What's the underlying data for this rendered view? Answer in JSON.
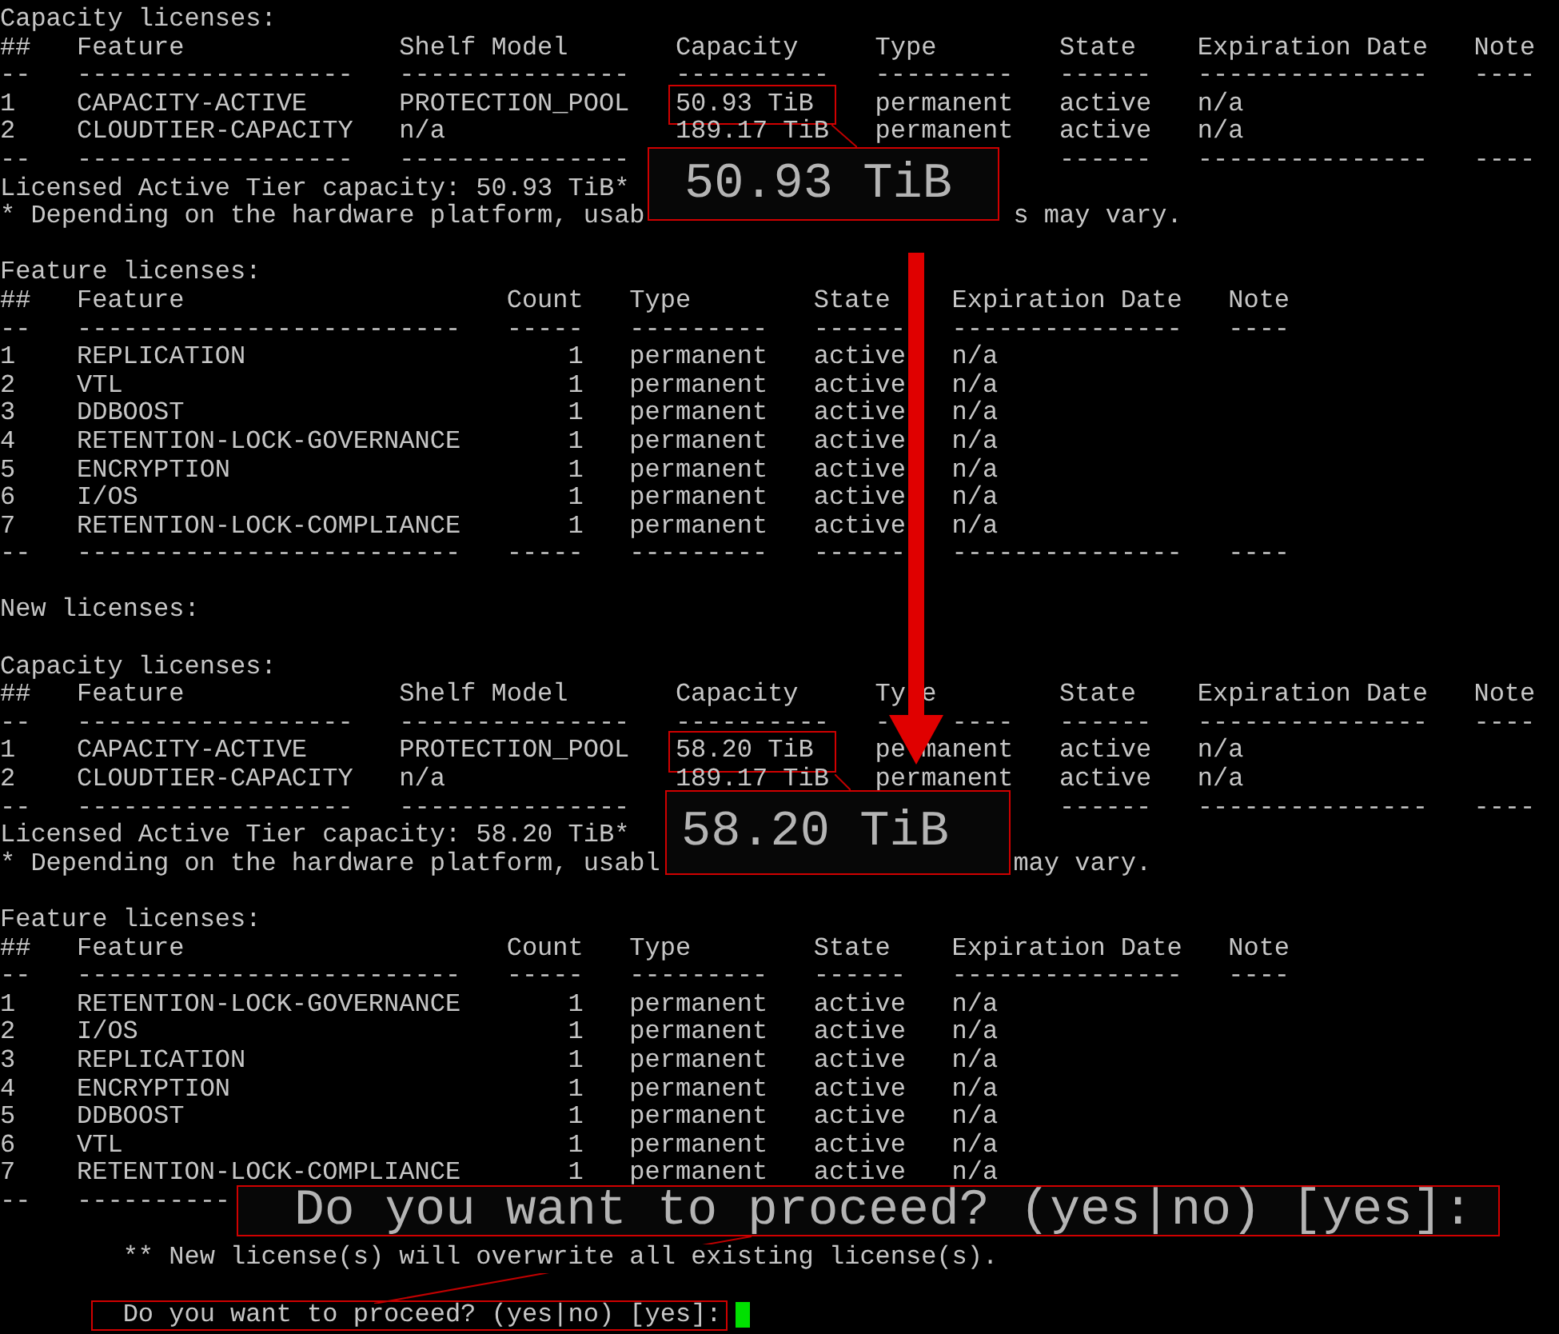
{
  "lines": [
    {
      "kind": "text",
      "text": "Capacity licenses:"
    },
    {
      "kind": "cap_header",
      "cells": [
        "##",
        "Feature",
        "Shelf Model",
        "Capacity",
        "Type",
        "State",
        "Expiration Date",
        "Note"
      ]
    },
    {
      "kind": "cap_rule",
      "cells": [
        "--",
        "------------------",
        "---------------",
        "----------",
        "---------",
        "------",
        "---------------",
        "----"
      ]
    },
    {
      "kind": "cap_row",
      "highlighted": true,
      "cells": [
        "1",
        "CAPACITY-ACTIVE",
        "PROTECTION_POOL",
        "50.93 TiB",
        "permanent",
        "active",
        "n/a"
      ]
    },
    {
      "kind": "cap_row",
      "highlighted": false,
      "cells": [
        "2",
        "CLOUDTIER-CAPACITY",
        "n/a",
        "189.17 TiB",
        "permanent",
        "active",
        "n/a"
      ]
    },
    {
      "kind": "cap_rule",
      "cells": [
        "--",
        "------------------",
        "---------------",
        null,
        null,
        "------",
        "---------------",
        "----"
      ]
    },
    {
      "kind": "text",
      "text": "Licensed Active Tier capacity: 50.93 TiB*"
    },
    {
      "kind": "split",
      "parts": [
        "* Depending on the hardware platform, usab",
        "s may vary."
      ]
    },
    {
      "kind": "blank"
    },
    {
      "kind": "text",
      "text": "Feature licenses:"
    },
    {
      "kind": "feat_header",
      "cells": [
        "##",
        "Feature",
        "Count",
        "Type",
        "State",
        "Expiration Date",
        "Note"
      ]
    },
    {
      "kind": "feat_rule",
      "cells": [
        "--",
        "-------------------------",
        "-----",
        "---------",
        "------",
        "---------------",
        "----"
      ]
    },
    {
      "kind": "feat_row",
      "highlighted": false,
      "cells": [
        "1",
        "REPLICATION",
        "1",
        "permanent",
        "active",
        "n/a"
      ]
    },
    {
      "kind": "feat_row",
      "highlighted": false,
      "cells": [
        "2",
        "VTL",
        "1",
        "permanent",
        "active",
        "n/a"
      ]
    },
    {
      "kind": "feat_row",
      "highlighted": false,
      "cells": [
        "3",
        "DDBOOST",
        "1",
        "permanent",
        "active",
        "n/a"
      ]
    },
    {
      "kind": "feat_row",
      "highlighted": false,
      "cells": [
        "4",
        "RETENTION-LOCK-GOVERNANCE",
        "1",
        "permanent",
        "active",
        "n/a"
      ]
    },
    {
      "kind": "feat_row",
      "highlighted": false,
      "cells": [
        "5",
        "ENCRYPTION",
        "1",
        "permanent",
        "active",
        "n/a"
      ]
    },
    {
      "kind": "feat_row",
      "highlighted": false,
      "cells": [
        "6",
        "I/OS",
        "1",
        "permanent",
        "active",
        "n/a"
      ]
    },
    {
      "kind": "feat_row",
      "highlighted": false,
      "cells": [
        "7",
        "RETENTION-LOCK-COMPLIANCE",
        "1",
        "permanent",
        "active",
        "n/a"
      ]
    },
    {
      "kind": "feat_rule",
      "cells": [
        "--",
        "-------------------------",
        "-----",
        "---------",
        "------",
        "---------------",
        "----"
      ]
    },
    {
      "kind": "blank"
    },
    {
      "kind": "text",
      "text": "New licenses:"
    },
    {
      "kind": "blank"
    },
    {
      "kind": "text",
      "text": "Capacity licenses:"
    },
    {
      "kind": "cap_header",
      "cells": [
        "##",
        "Feature",
        "Shelf Model",
        "Capacity",
        [
          "Ty",
          "e"
        ],
        "State",
        "Expiration Date",
        "Note"
      ]
    },
    {
      "kind": "cap_rule",
      "cells": [
        "--",
        "------------------",
        "---------------",
        "----------",
        [
          "-",
          "----"
        ],
        "------",
        "---------------",
        "----"
      ]
    },
    {
      "kind": "cap_row",
      "highlighted": true,
      "cells": [
        "1",
        "CAPACITY-ACTIVE",
        "PROTECTION_POOL",
        "58.20 TiB",
        [
          "pe",
          "manent"
        ],
        "active",
        "n/a"
      ]
    },
    {
      "kind": "cap_row",
      "highlighted": false,
      "cells": [
        "2",
        "CLOUDTIER-CAPACITY",
        "n/a",
        "189.17 TiB",
        "permanent",
        "active",
        "n/a"
      ]
    },
    {
      "kind": "cap_rule",
      "cells": [
        "--",
        "------------------",
        "---------------",
        null,
        null,
        "------",
        "---------------",
        "----"
      ]
    },
    {
      "kind": "text",
      "text": "Licensed Active Tier capacity: 58.20 TiB*"
    },
    {
      "kind": "split",
      "parts": [
        "* Depending on the hardware platform, usabl",
        "may vary."
      ]
    },
    {
      "kind": "blank"
    },
    {
      "kind": "text",
      "text": "Feature licenses:"
    },
    {
      "kind": "feat_header",
      "cells": [
        "##",
        "Feature",
        "Count",
        "Type",
        "State",
        "Expiration Date",
        "Note"
      ]
    },
    {
      "kind": "feat_rule",
      "cells": [
        "--",
        "-------------------------",
        "-----",
        "---------",
        "------",
        "---------------",
        "----"
      ]
    },
    {
      "kind": "feat_row",
      "highlighted": false,
      "cells": [
        "1",
        "RETENTION-LOCK-GOVERNANCE",
        "1",
        "permanent",
        "active",
        "n/a"
      ]
    },
    {
      "kind": "feat_row",
      "highlighted": false,
      "cells": [
        "2",
        "I/OS",
        "1",
        "permanent",
        "active",
        "n/a"
      ]
    },
    {
      "kind": "feat_row",
      "highlighted": false,
      "cells": [
        "3",
        "REPLICATION",
        "1",
        "permanent",
        "active",
        "n/a"
      ]
    },
    {
      "kind": "feat_row",
      "highlighted": false,
      "cells": [
        "4",
        "ENCRYPTION",
        "1",
        "permanent",
        "active",
        "n/a"
      ]
    },
    {
      "kind": "feat_row",
      "highlighted": false,
      "cells": [
        "5",
        "DDBOOST",
        "1",
        "permanent",
        "active",
        "n/a"
      ]
    },
    {
      "kind": "feat_row",
      "highlighted": false,
      "cells": [
        "6",
        "VTL",
        "1",
        "permanent",
        "active",
        "n/a"
      ]
    },
    {
      "kind": "feat_row",
      "highlighted": false,
      "cells": [
        "7",
        "RETENTION-LOCK-COMPLIANCE",
        "1",
        "permanent",
        "active",
        "n/a"
      ]
    },
    {
      "kind": "feat_rule",
      "cells": [
        "--",
        "----------",
        null,
        null,
        null,
        null,
        null
      ]
    },
    {
      "kind": "blank"
    },
    {
      "kind": "indented",
      "text": "** New license(s) will overwrite all existing license(s)."
    },
    {
      "kind": "blank"
    },
    {
      "kind": "prompt",
      "text": "Do you want to proceed? (yes|no) [yes]:",
      "highlighted": true,
      "cursor": true
    }
  ],
  "callouts": [
    {
      "text": "50.93 TiB"
    },
    {
      "text": "58.20 TiB"
    },
    {
      "text": "Do you want to proceed? (yes|no) [yes]:"
    }
  ]
}
